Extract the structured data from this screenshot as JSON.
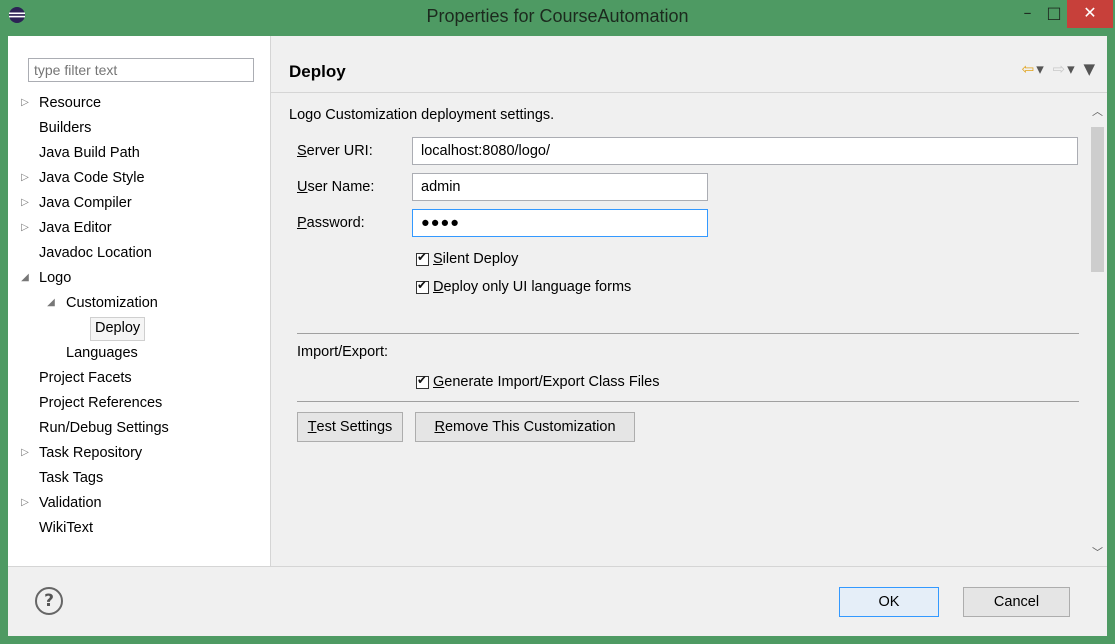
{
  "window": {
    "title": "Properties for CourseAutomation",
    "minimize_glyph": "–",
    "maximize_glyph": "□",
    "close_glyph": "✕"
  },
  "filter": {
    "placeholder": "type filter text"
  },
  "tree": [
    {
      "label": "Resource",
      "expander": "collapsed"
    },
    {
      "label": "Builders",
      "expander": "none"
    },
    {
      "label": "Java Build Path",
      "expander": "none"
    },
    {
      "label": "Java Code Style",
      "expander": "collapsed"
    },
    {
      "label": "Java Compiler",
      "expander": "collapsed"
    },
    {
      "label": "Java Editor",
      "expander": "collapsed"
    },
    {
      "label": "Javadoc Location",
      "expander": "none"
    },
    {
      "label": "Logo",
      "expander": "expanded"
    },
    {
      "label": "Customization",
      "expander": "expanded"
    },
    {
      "label": "Deploy",
      "expander": "none",
      "selected": true
    },
    {
      "label": "Languages",
      "expander": "none"
    },
    {
      "label": "Project Facets",
      "expander": "none"
    },
    {
      "label": "Project References",
      "expander": "none"
    },
    {
      "label": "Run/Debug Settings",
      "expander": "none"
    },
    {
      "label": "Task Repository",
      "expander": "collapsed"
    },
    {
      "label": "Task Tags",
      "expander": "none"
    },
    {
      "label": "Validation",
      "expander": "collapsed"
    },
    {
      "label": "WikiText",
      "expander": "none"
    }
  ],
  "page": {
    "title": "Deploy",
    "description": "Logo Customization deployment settings.",
    "server_uri": {
      "label_mnemonic": "S",
      "label_rest": "erver URI:",
      "value": "localhost:8080/logo/"
    },
    "user_name": {
      "label_mnemonic": "U",
      "label_rest": "ser Name:",
      "value": "admin"
    },
    "password": {
      "label_mnemonic": "P",
      "label_rest": "assword:",
      "value": "●●●●"
    },
    "silent_deploy": {
      "mnemonic": "S",
      "rest": "ilent Deploy",
      "checked": true
    },
    "deploy_ui_only": {
      "mnemonic": "D",
      "rest": "eploy only UI language forms",
      "checked": true
    },
    "import_export_label": "Import/Export:",
    "generate_files": {
      "mnemonic": "G",
      "rest": "enerate Import/Export Class Files",
      "checked": true
    },
    "test_settings": {
      "mnemonic": "T",
      "rest": "est Settings"
    },
    "remove_customization": {
      "mnemonic": "R",
      "rest": "emove This Customization"
    }
  },
  "footer": {
    "help_glyph": "?",
    "ok_label": "OK",
    "cancel_label": "Cancel"
  },
  "colors": {
    "titlebar": "#4e9a63",
    "close_button": "#c7403a",
    "focus_border": "#3399ff"
  }
}
